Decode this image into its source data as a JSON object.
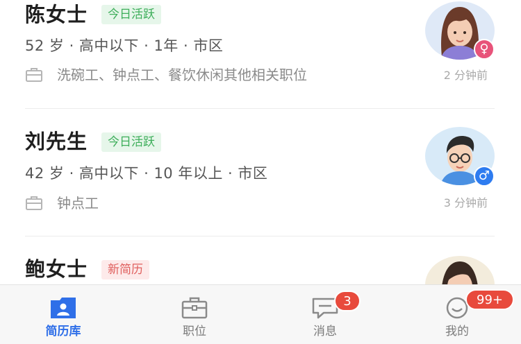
{
  "candidates": [
    {
      "name": "陈女士",
      "tag": "今日活跃",
      "meta": "52 岁 · 高中以下 · 1年 · 市区",
      "jobs": "洗碗工、钟点工、餐饮休闲其他相关职位",
      "time": "2 分钟前",
      "gender": "female",
      "gender_symbol": "♀"
    },
    {
      "name": "刘先生",
      "tag": "今日活跃",
      "meta": "42 岁 · 高中以下 · 10 年以上 · 市区",
      "jobs": "钟点工",
      "time": "3 分钟前",
      "gender": "male",
      "gender_symbol": "♂"
    },
    {
      "name": "鲍女士",
      "tag": "新简历",
      "gender": "female"
    }
  ],
  "tabbar": {
    "tabs": [
      {
        "label": "简历库",
        "icon": "resume-library-icon",
        "selected": true
      },
      {
        "label": "职位",
        "icon": "briefcase-icon",
        "selected": false
      },
      {
        "label": "消息",
        "icon": "message-icon",
        "selected": false,
        "badge": "3"
      },
      {
        "label": "我的",
        "icon": "smile-icon",
        "selected": false,
        "badge": "99+"
      }
    ]
  },
  "colors": {
    "accent": "#2f6fe8",
    "active_tag_text": "#3dae5a",
    "active_tag_bg": "#e6f6ea",
    "new_tag_text": "#e0605e",
    "new_tag_bg": "#fdeaea",
    "badge": "#e84a3c",
    "female": "#e8537a",
    "male": "#2e7cf0"
  }
}
